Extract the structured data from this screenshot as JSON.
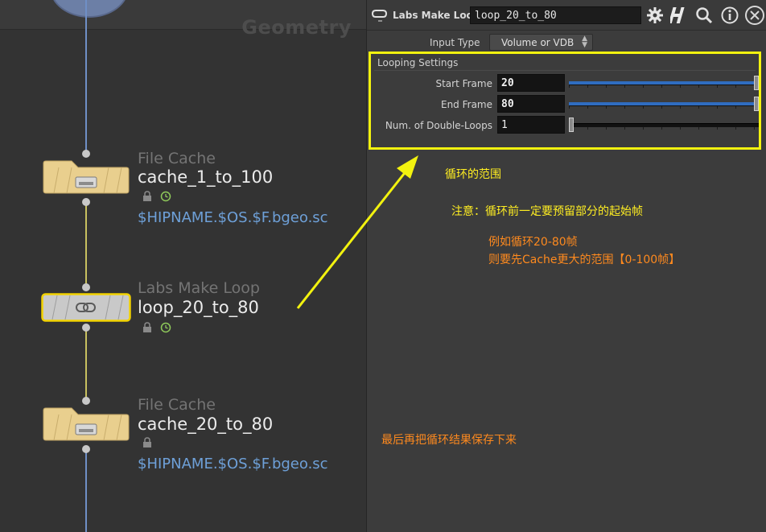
{
  "network": {
    "context_label": "Geometry",
    "nodes": [
      {
        "type": "File Cache",
        "name": "cache_1_to_100",
        "path": "$HIPNAME.$OS.$F.bgeo.sc"
      },
      {
        "type": "Labs Make Loop",
        "name": "loop_20_to_80"
      },
      {
        "type": "File Cache",
        "name": "cache_20_to_80",
        "path": "$HIPNAME.$OS.$F.bgeo.sc"
      }
    ]
  },
  "params": {
    "node_type": "Labs Make Loop",
    "node_name": "loop_20_to_80",
    "header_icons": [
      "loop-icon",
      "gear-icon",
      "houdini-help-icon",
      "search-icon",
      "info-icon",
      "close-icon"
    ],
    "input_type": {
      "label": "Input Type",
      "value": "Volume or VDB"
    },
    "looping": {
      "title": "Looping Settings",
      "rows": [
        {
          "label": "Start Frame",
          "value": "20",
          "slider_fraction": 1.0
        },
        {
          "label": "End Frame",
          "value": "80",
          "slider_fraction": 1.0
        },
        {
          "label": "Num. of Double-Loops",
          "value": "1",
          "slider_fraction": 0.0
        }
      ]
    }
  },
  "annotations": {
    "loop_range": "循环的范围",
    "notice": "注意：循环前一定要预留部分的起始帧",
    "example_line1": "例如循环20-80帧",
    "example_line2": "则要先Cache更大的范围【0-100帧】",
    "final": "最后再把循环结果保存下来"
  },
  "colors": {
    "highlight_yellow": "#f2f20f",
    "annotation_yellow": "#ffee22",
    "annotation_orange": "#ff8a1e",
    "path_blue": "#6ea0d8",
    "slider_blue": "#2f6dc0",
    "file_cache_node": "#e9cf8e",
    "make_loop_node": "#c9c9c9"
  }
}
